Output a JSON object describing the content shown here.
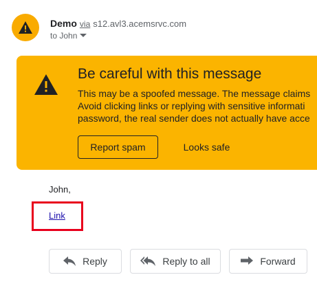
{
  "header": {
    "sender_name": "Demo",
    "via_label": "via",
    "sender_domain": "s12.avl3.acemsrvc.com",
    "recipient": "to John"
  },
  "banner": {
    "title": "Be careful with this message",
    "body_lines": [
      "This may be a spoofed message. The message claims",
      "Avoid clicking links or replying with sensitive informati",
      "password, the real sender does not actually have acce"
    ],
    "report_spam_label": "Report spam",
    "looks_safe_label": "Looks safe",
    "background_color": "#fbb400"
  },
  "message": {
    "greeting": "John,",
    "link_text": "Link",
    "highlight_color": "#e8001c"
  },
  "actions": {
    "reply_label": "Reply",
    "reply_all_label": "Reply to all",
    "forward_label": "Forward"
  },
  "icons": {
    "avatar": "warning-icon",
    "banner": "warning-icon",
    "recipient_toggle": "caret-down-icon",
    "reply": "reply-icon",
    "reply_all": "reply-all-icon",
    "forward": "forward-icon"
  }
}
